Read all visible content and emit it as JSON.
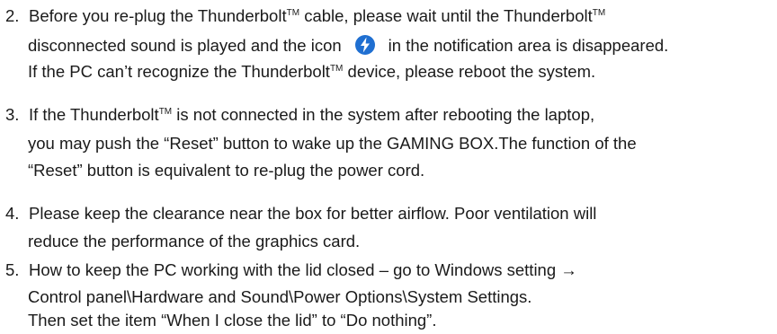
{
  "items": [
    {
      "number": "2.",
      "lines": [
        {
          "pre": "Before you re-plug the Thunderbolt",
          "tm": "TM",
          "post": " cable, please wait until the Thunderbolt",
          "tm2": "TM"
        },
        {
          "pre": "disconnected sound is played and the icon",
          "post": "in the notification area is disappeared."
        },
        {
          "pre": "If the PC can’t recognize the Thunderbolt",
          "tm": "TM",
          "post": " device, please reboot the system."
        }
      ]
    },
    {
      "number": "3.",
      "lines": [
        {
          "pre": "If the Thunderbolt",
          "tm": "TM",
          "post": " is not connected in the system after rebooting the laptop,"
        },
        {
          "text": "you may push the “Reset” button to wake up the GAMING BOX.The function of the"
        },
        {
          "text": "“Reset” button is equivalent to re-plug the power cord."
        }
      ]
    },
    {
      "number": "4.",
      "lines": [
        {
          "text": "Please keep the clearance near the box for better airflow. Poor ventilation will"
        },
        {
          "text": "reduce the performance of the graphics card."
        }
      ]
    },
    {
      "number": "5.",
      "lines": [
        {
          "text": "How to keep the PC working with the lid closed – go to Windows setting →"
        },
        {
          "text": "Control panel\\Hardware and Sound\\Power Options\\System Settings."
        },
        {
          "text": "Then set the item “When I close the lid” to “Do nothing”."
        }
      ]
    }
  ],
  "icon": {
    "name": "thunderbolt-icon",
    "color": "#1f6fd1"
  }
}
